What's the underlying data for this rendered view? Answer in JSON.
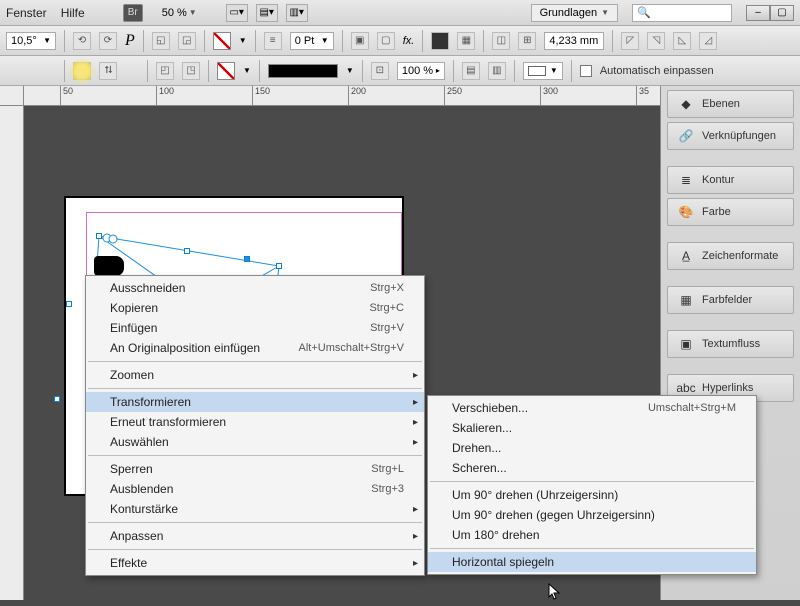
{
  "menubar": {
    "items": [
      "Fenster",
      "Hilfe"
    ],
    "br": "Br",
    "zoom": "50 %",
    "workspace_label": "Grundlagen",
    "search_placeholder": ""
  },
  "options1": {
    "rotation": "10,5°",
    "stroke_weight": "0 Pt",
    "ref_dim": "4,233 mm"
  },
  "options2": {
    "opacity": "100 %",
    "auto_fit": "Automatisch einpassen"
  },
  "ruler_ticks": [
    "50",
    "100",
    "150",
    "200",
    "250",
    "300",
    "35"
  ],
  "dock": {
    "panels": [
      {
        "icon": "◆",
        "label": "Ebenen"
      },
      {
        "icon": "🔗",
        "label": "Verknüpfungen"
      },
      {
        "icon": "≣",
        "label": "Kontur"
      },
      {
        "icon": "🎨",
        "label": "Farbe"
      },
      {
        "icon": "A̲",
        "label": "Zeichenformate"
      },
      {
        "icon": "▦",
        "label": "Farbfelder"
      },
      {
        "icon": "▣",
        "label": "Textumfluss"
      },
      {
        "icon": "abc",
        "label": "Hyperlinks"
      }
    ]
  },
  "context_menu": {
    "items": [
      {
        "label": "Ausschneiden",
        "shortcut": "Strg+X"
      },
      {
        "label": "Kopieren",
        "shortcut": "Strg+C"
      },
      {
        "label": "Einfügen",
        "shortcut": "Strg+V"
      },
      {
        "label": "An Originalposition einfügen",
        "shortcut": "Alt+Umschalt+Strg+V"
      },
      {
        "divider": true
      },
      {
        "label": "Zoomen",
        "sub": true
      },
      {
        "divider": true
      },
      {
        "label": "Transformieren",
        "sub": true,
        "hover": true
      },
      {
        "label": "Erneut transformieren",
        "sub": true
      },
      {
        "label": "Auswählen",
        "sub": true
      },
      {
        "divider": true
      },
      {
        "label": "Sperren",
        "shortcut": "Strg+L"
      },
      {
        "label": "Ausblenden",
        "shortcut": "Strg+3"
      },
      {
        "label": "Konturstärke",
        "sub": true
      },
      {
        "divider": true
      },
      {
        "label": "Anpassen",
        "sub": true
      },
      {
        "divider": true
      },
      {
        "label": "Effekte",
        "sub": true
      }
    ]
  },
  "submenu": {
    "items": [
      {
        "label": "Verschieben...",
        "shortcut": "Umschalt+Strg+M"
      },
      {
        "label": "Skalieren..."
      },
      {
        "label": "Drehen..."
      },
      {
        "label": "Scheren..."
      },
      {
        "divider": true
      },
      {
        "label": "Um 90° drehen (Uhrzeigersinn)"
      },
      {
        "label": "Um 90° drehen (gegen Uhrzeigersinn)"
      },
      {
        "label": "Um 180° drehen"
      },
      {
        "divider": true
      },
      {
        "label": "Horizontal spiegeln",
        "hover": true
      }
    ]
  }
}
